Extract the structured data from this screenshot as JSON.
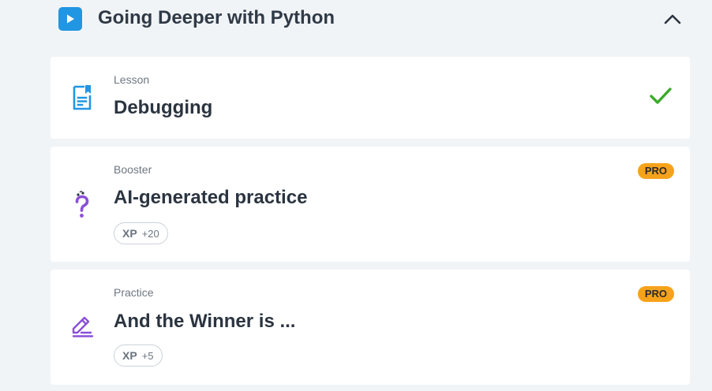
{
  "section": {
    "title": "Going Deeper with Python"
  },
  "cards": [
    {
      "type": "Lesson",
      "title": "Debugging",
      "icon": "lesson-document-icon",
      "status": "completed"
    },
    {
      "type": "Booster",
      "title": "AI-generated practice",
      "icon": "question-mark-icon",
      "badge": "PRO",
      "xp_label": "XP",
      "xp_value": "+20"
    },
    {
      "type": "Practice",
      "title": "And the Winner is ...",
      "icon": "pencil-icon",
      "badge": "PRO",
      "xp_label": "XP",
      "xp_value": "+5"
    }
  ],
  "colors": {
    "background": "#f1f4f7",
    "accent_blue": "#2196e3",
    "purple": "#8a4fd8",
    "check_green": "#3aab2a",
    "pro_orange": "#f7a21b"
  }
}
